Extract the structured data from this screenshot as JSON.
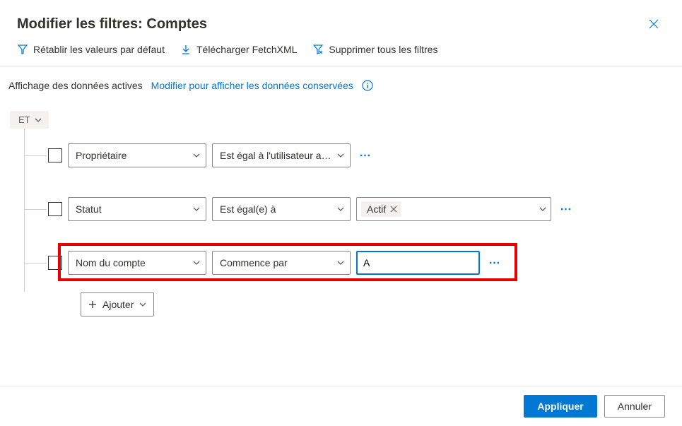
{
  "header": {
    "title": "Modifier les filtres: Comptes"
  },
  "toolbar": {
    "reset": "Rétablir les valeurs par défaut",
    "download": "Télécharger FetchXML",
    "clear": "Supprimer tous les filtres"
  },
  "subbar": {
    "active": "Affichage des données actives",
    "link": "Modifier pour afficher les données conservées"
  },
  "group": {
    "operator": "ET"
  },
  "rows": [
    {
      "field": "Propriétaire",
      "operator": "Est égal à l'utilisateur ac…",
      "value": null
    },
    {
      "field": "Statut",
      "operator": "Est égal(e) à",
      "tag": "Actif"
    },
    {
      "field": "Nom du compte",
      "operator": "Commence par",
      "input": "A"
    }
  ],
  "add_label": "Ajouter",
  "footer": {
    "apply": "Appliquer",
    "cancel": "Annuler"
  }
}
